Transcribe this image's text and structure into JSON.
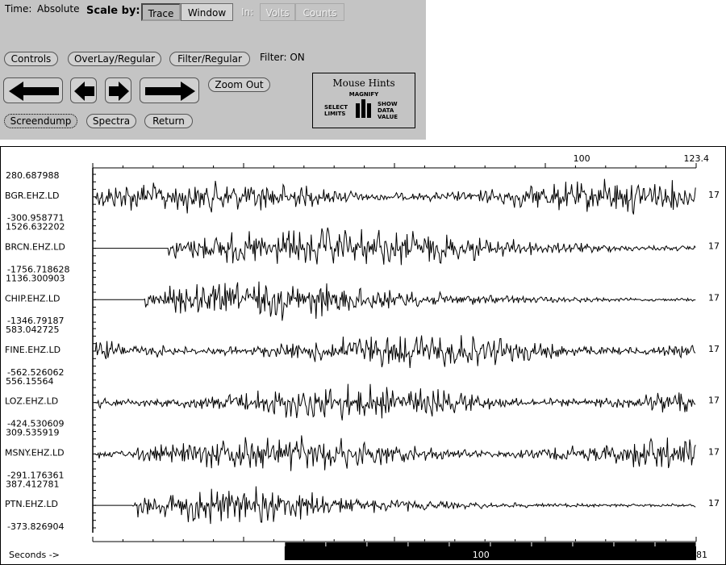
{
  "controls": {
    "time_label": "Time:",
    "time_value": "Absolute",
    "scale_by_label": "Scale by:",
    "scale_trace": "Trace",
    "scale_window": "Window",
    "in_label": "In:",
    "in_volts": "Volts",
    "in_counts": "Counts",
    "controls_button": "Controls",
    "overlay_button": "OverLay/Regular",
    "filter_button": "Filter/Regular",
    "filter_status": "Filter: ON",
    "zoom_out_button": "Zoom Out",
    "screendump_button": "Screendump",
    "spectra_button": "Spectra",
    "return_button": "Return"
  },
  "mouse_hints": {
    "title": "Mouse Hints",
    "magnify": "MAGNIFY",
    "select_limits": [
      "SELECT",
      "LIMITS"
    ],
    "show_data_value": [
      "SHOW",
      "DATA",
      "VALUE"
    ]
  },
  "plot": {
    "top_axis": {
      "ticks": [
        "100"
      ],
      "end_label": "123.4"
    },
    "bottom_axis": {
      "label": "Seconds ->",
      "ticks": [
        "100"
      ],
      "end_label": "181"
    },
    "traces": [
      {
        "name": "BGR.EHZ.LD",
        "max": "280.687988",
        "min": "-300.958771",
        "right": "17",
        "onset": 0.0,
        "quiet_after": 1.0
      },
      {
        "name": "BRCN.EHZ.LD",
        "max": "1526.632202",
        "min": "-1756.718628",
        "right": "17",
        "onset": 0.12,
        "quiet_after": 0.62
      },
      {
        "name": "CHIP.EHZ.LD",
        "max": "1136.300903",
        "min": "-1346.79187",
        "right": "17",
        "onset": 0.08,
        "quiet_after": 0.45
      },
      {
        "name": "FINE.EHZ.LD",
        "max": "583.042725",
        "min": "-562.526062",
        "right": "17",
        "onset": 0.0,
        "quiet_after": 1.0
      },
      {
        "name": "LOZ.EHZ.LD",
        "max": "556.15564",
        "min": "-424.530609",
        "right": "17",
        "onset": 0.0,
        "quiet_after": 1.0
      },
      {
        "name": "MSNY.EHZ.LD",
        "max": "309.535919",
        "min": "-291.176361",
        "right": "17",
        "onset": 0.0,
        "quiet_after": 1.0
      },
      {
        "name": "PTN.EHZ.LD",
        "max": "387.412781",
        "min": "-373.826904",
        "right": "17",
        "onset": 0.06,
        "quiet_after": 0.35
      }
    ]
  }
}
